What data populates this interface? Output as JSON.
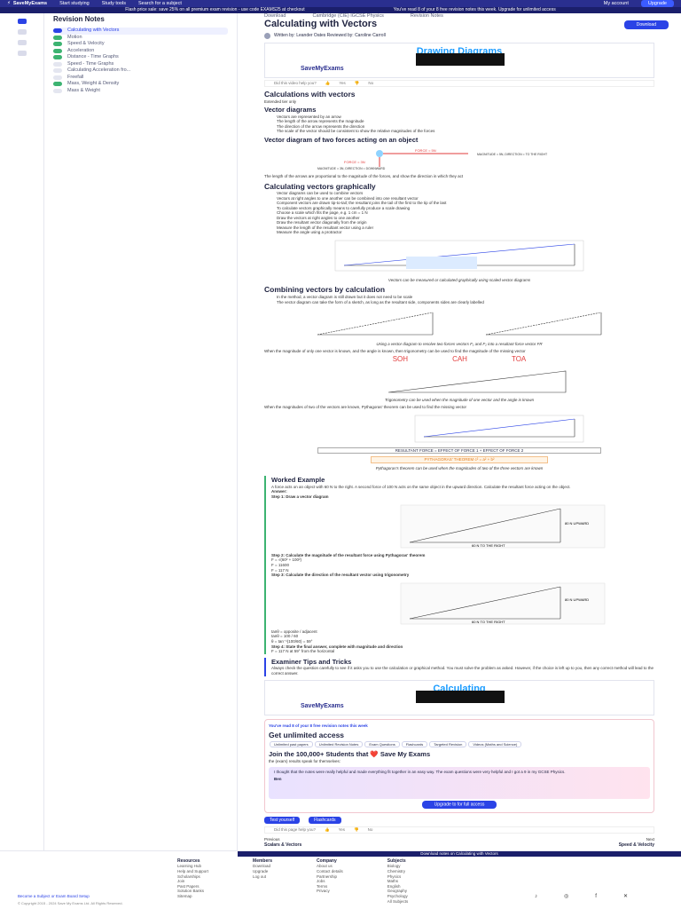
{
  "topbar": {
    "logo": "SaveMyExams",
    "nav": [
      "Start studying",
      "Study tools",
      "Search for a subject"
    ],
    "account": "My account",
    "upgrade": "Upgrade"
  },
  "promo": {
    "left": "Flash price sale: save 25% on all premium exam revision - use code EXAMS25 at checkout",
    "right": "You've read 8 of your 8 free revision notes this week. Upgrade for unlimited access"
  },
  "sidebar": {
    "title": "Revision Notes",
    "items": [
      {
        "label": "Calculating with Vectors",
        "state": "cur"
      },
      {
        "label": "Motion",
        "state": "done"
      },
      {
        "label": "Speed & Velocity",
        "state": "done"
      },
      {
        "label": "Acceleration",
        "state": "done"
      },
      {
        "label": "Distance - Time Graphs",
        "state": "done"
      },
      {
        "label": "Speed - Time Graphs",
        "state": "todo"
      },
      {
        "label": "Calculating Acceleration fro...",
        "state": "todo"
      },
      {
        "label": "Freefall",
        "state": "todo"
      },
      {
        "label": "Mass, Weight & Density",
        "state": "done"
      },
      {
        "label": "Mass & Weight",
        "state": "todo"
      }
    ]
  },
  "main": {
    "tabs": [
      "Download",
      "Cambridge (CIE) IGCSE Physics",
      "Revision Notes"
    ],
    "title": "Calculating with Vectors",
    "download": "Download",
    "author": "Written by: Leander Oates  Reviewed by: Caroline Carroll",
    "video_title": "Drawing Diagrams",
    "video_brand": "SaveMyExams",
    "helpful": "Did this video help you?",
    "yes": "Yes",
    "no": "No",
    "h_calc": "Calculations with vectors",
    "extended": "Extended tier only",
    "vector_diagrams": "Vector diagrams",
    "vd_bullets": [
      "Vectors are represented by an arrow",
      "The length of the arrow represents the magnitude",
      "The direction of the arrow represents the direction",
      "The scale of the vector should be consistent to show the relative magnitudes of the forces"
    ],
    "vd_fig_caption": "Vector diagram of two forces acting on an object",
    "vd_labels": [
      "FORCE = 5N",
      "FORCE = 3N",
      "MAGNITUDE = 5N, DIRECTION = TO THE RIGHT",
      "MAGNITUDE = 3N, DIRECTION = DOWNWARD"
    ],
    "vd_note": "The length of the arrows are proportional to the magnitude of the forces, and show the direction in which they act",
    "h_graph": "Calculating vectors graphically",
    "graph_steps": [
      "Vector diagrams can be used to combine vectors",
      "Vectors at right angles to one another can be combined into one resultant vector",
      "Component vectors are drawn tip-to-tail; the resultant joins the tail of the first to the tip of the last",
      "To calculate vectors graphically means to carefully produce a scale drawing",
      "Choose a scale which fits the page, e.g. 1 cm = 1 N",
      "Draw the vectors at right angles to one another",
      "Draw the resultant vector diagonally from the origin",
      "Measure the length of the resultant vector using a ruler",
      "Measure the angle using a protractor"
    ],
    "graph_caption": "Vectors can be measured or calculated graphically using scaled vector diagrams",
    "h_combine": "Combining vectors by calculation",
    "combine_bullets": [
      "In the method, a vector diagram is still drawn but it does not need to be scale",
      "The vector diagram can take the form of a sketch, as long as the resultant side, components sides are clearly labelled"
    ],
    "combine_caption": "Using a vector diagram to resolve two forces vectors F₁ and F₂ into a resultant force vector FR",
    "trig_note": "When the magnitude of only one vector is known, and the angle is known, then trigonometry can be used to find the magnitude of the missing vector",
    "soh": "SOH",
    "cah": "CAH",
    "toa": "TOA",
    "trig_caption": "Trigonometry can be used when the magnitude of one vector and the angle is known",
    "pyth_note": "When the magnitudes of two of the vectors are known, Pythagoras' theorem can be used to find the missing vector",
    "resultant_box": "RESULTANT FORCE = EFFECT OF FORCE 1 + EFFECT OF FORCE 2",
    "pyth_box": "PYTHAGORAS' THEOREM  c² = a² + b²",
    "pyth_caption": "Pythagoras's theorem can be used when the magnitudes of two of the three vectors are known",
    "worked_title": "Worked Example",
    "worked_q": "A force acts on an object with 60 N to the right. A second force of 100 N acts on the same object in the upward direction. Calculate the resultant force acting on the object.",
    "answer": "Answer:",
    "step1": "Step 1: Draw a vector diagram",
    "w_up": "80 N UPWARD",
    "w_right": "60 N TO THE RIGHT",
    "step2": "Step 2: Calculate the magnitude of the resultant force using Pythagoras' theorem",
    "step2_eqs": [
      "F = √(60² + 100²)",
      "F = 11600",
      "F = 117 N"
    ],
    "step3": "Step 3: Calculate the direction of the resultant vector using trigonometry",
    "step3_eqs": [
      "tanθ = opposite / adjacent",
      "tanθ = 100 / 60",
      "θ = tan⁻¹(100/60) = 59°"
    ],
    "step4": "Step 4: State the final answer, complete with magnitude and direction",
    "step4_eq": "F = 117 N at 59° from the horizontal",
    "tips_title": "Examiner Tips and Tricks",
    "tips_text": "Always check the question carefully to see if it asks you to use the calculation or graphical method. You must solve the problem as asked. However, if the choice is left up to you, then any correct method will lead to the correct answer.",
    "video2_title": "Calculating",
    "cta_read": "You've read 8 of your 8 free revision notes this week",
    "cta_title": "Get unlimited access",
    "chips": [
      "Unlimited past papers",
      "Unlimited Revision Notes",
      "Exam Questions",
      "Flashcards",
      "Targeted Revision",
      "Videos (Maths and Science)"
    ],
    "join": "Join the 100,000+ Students that ❤️ Save My Exams",
    "join_sub": "the (exam) results speak for themselves:",
    "quote": "I thought that the notes were really helpful and made everything fit together in an easy way. The exam questions were very helpful and I got a 9 in my GCSE Physics.",
    "quote_author": "Ben",
    "upgrade_cta": "Upgrade to for full access",
    "test_yourself": "Test yourself",
    "flashcards": "Flashcards",
    "helpful2": "Did this page help you?",
    "prev": "Scalars & Vectors",
    "next": "Speed & Velocity",
    "prev_label": "Previous",
    "next_label": "Next"
  },
  "footer": {
    "strip": "Download notes on Calculating with Vectors",
    "cols": [
      {
        "title": "Resources",
        "items": [
          "Learning Hub",
          "Help and Support",
          "Scholarships",
          "Join",
          "Past Papers",
          "Solution Banks",
          "Sitemap"
        ]
      },
      {
        "title": "Members",
        "items": [
          "Download",
          "Upgrade",
          "Log out"
        ]
      },
      {
        "title": "Company",
        "items": [
          "About us",
          "Contact details",
          "Partnership",
          "Jobs",
          "Terms",
          "Privacy"
        ]
      },
      {
        "title": "Subjects",
        "items": [
          "Biology",
          "Chemistry",
          "Physics",
          "Maths",
          "English",
          "Geography",
          "Psychology",
          "All Subjects"
        ]
      }
    ],
    "bottom_link": "Become a Subject or Exam Board Setup",
    "copy": "© Copyright 2015 - 2024 Save My Exams Ltd. All Rights Reserved."
  },
  "colors": {
    "brand": "#2a2f8f",
    "accent": "#2b43e6",
    "success": "#3cb371",
    "video_text": "#1a9bff"
  }
}
